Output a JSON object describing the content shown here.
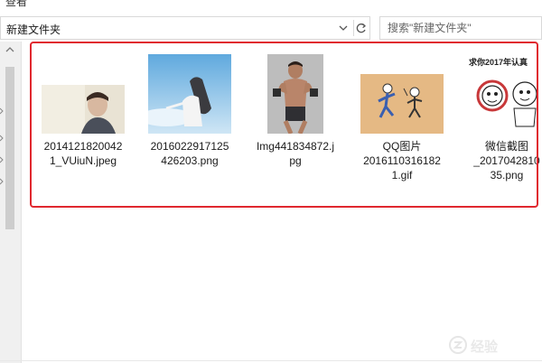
{
  "window": {
    "menu_label": "查看"
  },
  "address": {
    "path": "新建文件夹",
    "dropdown_icon": "chevron-down-icon",
    "refresh_icon": "refresh-icon"
  },
  "search": {
    "placeholder": "搜索\"新建文件夹\""
  },
  "files": [
    {
      "name_line1": "2014121820042",
      "name_line2": "1_VUiuN.jpeg",
      "name_line3": ""
    },
    {
      "name_line1": "2016022917125",
      "name_line2": "426203.png",
      "name_line3": ""
    },
    {
      "name_line1": "Img441834872.j",
      "name_line2": "pg",
      "name_line3": ""
    },
    {
      "name_line1": "QQ图片",
      "name_line2": "2016110316182",
      "name_line3": "1.gif"
    },
    {
      "name_line1": "微信截图",
      "name_line2": "_2017042810",
      "name_line3": "35.png"
    }
  ],
  "thumbnails": {
    "meme_caption": "求你2017年认真"
  },
  "watermark": {
    "text": "经验"
  },
  "colors": {
    "highlight_border": "#e0282f",
    "pane_background": "#f0f0f0"
  }
}
